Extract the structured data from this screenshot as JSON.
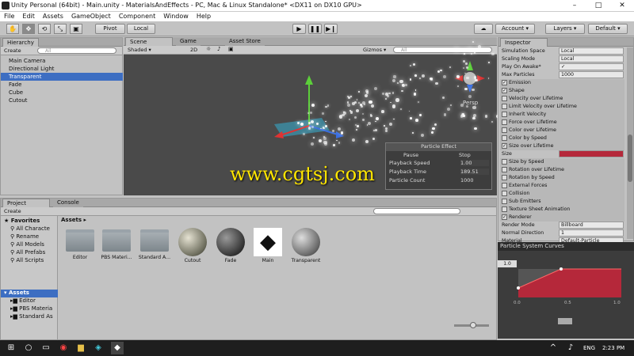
{
  "window": {
    "title": "Unity Personal (64bit) - Main.unity - MaterialsAndEffects - PC, Mac & Linux Standalone* <DX11 on DX10 GPU>",
    "min": "–",
    "max": "□",
    "close": "✕"
  },
  "menu": [
    "File",
    "Edit",
    "Assets",
    "GameObject",
    "Component",
    "Window",
    "Help"
  ],
  "toolbar": {
    "pivot": "Pivot",
    "local": "Local",
    "account": "Account",
    "layers": "Layers",
    "layout": "Default",
    "tools": [
      "✋",
      "✥",
      "⟲",
      "⤡",
      "▣"
    ]
  },
  "hierarchy": {
    "tab": "Hierarchy",
    "create": "Create",
    "search": "All",
    "items": [
      "Main Camera",
      "Directional Light",
      "Transparent",
      "Fade",
      "Cube",
      "Cutout"
    ]
  },
  "scene": {
    "tabs": [
      "Scene",
      "Game",
      "Asset Store"
    ],
    "shading": "Shaded",
    "mode2d": "2D",
    "gizmos": "Gizmos",
    "search": "All",
    "persp": "Persp",
    "effect": {
      "title": "Particle Effect",
      "pause": "Pause",
      "stop": "Stop",
      "rows": [
        {
          "label": "Playback Speed",
          "value": "1.00"
        },
        {
          "label": "Playback Time",
          "value": "189.51"
        },
        {
          "label": "Particle Count",
          "value": "1000"
        }
      ]
    }
  },
  "watermark": "www.cgtsj.com",
  "inspector": {
    "tab": "Inspector",
    "rows": [
      {
        "label": "Simulation Space",
        "value": "Local"
      },
      {
        "label": "Scaling Mode",
        "value": "Local"
      },
      {
        "label": "Play On Awake*",
        "value": "✓"
      },
      {
        "label": "Max Particles",
        "value": "1000"
      }
    ],
    "modules": [
      {
        "label": "Emission",
        "checked": true
      },
      {
        "label": "Shape",
        "checked": true
      },
      {
        "label": "Velocity over Lifetime",
        "checked": false
      },
      {
        "label": "Limit Velocity over Lifetime",
        "checked": false
      },
      {
        "label": "Inherit Velocity",
        "checked": false
      },
      {
        "label": "Force over Lifetime",
        "checked": false
      },
      {
        "label": "Color over Lifetime",
        "checked": false
      },
      {
        "label": "Color by Speed",
        "checked": false
      },
      {
        "label": "Size over Lifetime",
        "checked": true
      }
    ],
    "size_label": "Size",
    "modules2": [
      {
        "label": "Size by Speed",
        "checked": false
      },
      {
        "label": "Rotation over Lifetime",
        "checked": false
      },
      {
        "label": "Rotation by Speed",
        "checked": false
      },
      {
        "label": "External Forces",
        "checked": false
      },
      {
        "label": "Collision",
        "checked": false
      },
      {
        "label": "Sub Emitters",
        "checked": false
      },
      {
        "label": "Texture Sheet Animation",
        "checked": false
      },
      {
        "label": "Renderer",
        "checked": true
      }
    ],
    "renderer": [
      {
        "label": "Render Mode",
        "value": "Billboard"
      },
      {
        "label": "Normal Direction",
        "value": "1"
      },
      {
        "label": "Material",
        "value": "Default-Particle"
      }
    ]
  },
  "curves": {
    "title": "Particle System Curves",
    "ymax": "1.0",
    "ticks": [
      "0.0",
      "0.5",
      "1.0"
    ]
  },
  "project": {
    "tabs": [
      "Project",
      "Console"
    ],
    "create": "Create",
    "favorites": "Favorites",
    "fav_items": [
      "All Characte",
      "Rename",
      "All Models",
      "All Prefabs",
      "All Scripts"
    ],
    "assets_root": "Assets",
    "asset_folders": [
      "Editor",
      "PBS Materia",
      "Standard As"
    ],
    "breadcrumb": "Assets ▸",
    "assets": [
      {
        "name": "Editor",
        "kind": "folder"
      },
      {
        "name": "PBS Materi...",
        "kind": "folder"
      },
      {
        "name": "Standard A...",
        "kind": "folder"
      },
      {
        "name": "Cutout",
        "kind": "sphere"
      },
      {
        "name": "Fade",
        "kind": "sphere"
      },
      {
        "name": "Main",
        "kind": "unity"
      },
      {
        "name": "Transparent",
        "kind": "sphere"
      }
    ]
  },
  "taskbar": {
    "lang": "ENG",
    "time": "2:23 PM"
  }
}
